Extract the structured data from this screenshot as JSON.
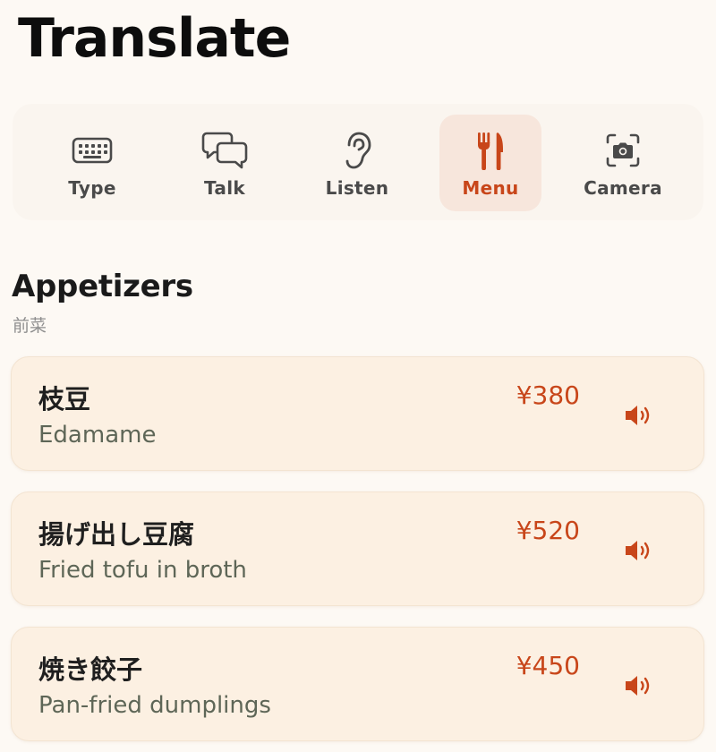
{
  "header": {
    "title": "Translate"
  },
  "tabs": [
    {
      "key": "type",
      "label": "Type",
      "icon": "keyboard-icon",
      "active": false
    },
    {
      "key": "talk",
      "label": "Talk",
      "icon": "chat-bubbles-icon",
      "active": false
    },
    {
      "key": "listen",
      "label": "Listen",
      "icon": "ear-icon",
      "active": false
    },
    {
      "key": "menu",
      "label": "Menu",
      "icon": "fork-knife-icon",
      "active": true
    },
    {
      "key": "camera",
      "label": "Camera",
      "icon": "camera-icon",
      "active": false
    }
  ],
  "section": {
    "title": "Appetizers",
    "subtitle": "前菜"
  },
  "items": [
    {
      "jp": "枝豆",
      "en": "Edamame",
      "price": "¥380"
    },
    {
      "jp": "揚げ出し豆腐",
      "en": "Fried tofu in broth",
      "price": "¥520"
    },
    {
      "jp": "焼き餃子",
      "en": "Pan-fried dumplings",
      "price": "¥450"
    }
  ],
  "colors": {
    "accent": "#c8461a",
    "background": "#fdf9f4",
    "card": "#fcf0e2",
    "active_tab": "#f7e6dc",
    "icon": "#4a4a4a"
  }
}
